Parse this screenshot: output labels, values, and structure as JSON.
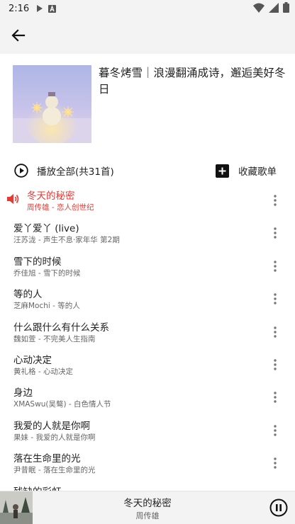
{
  "status": {
    "time": "2:16",
    "icons": [
      "play-icon",
      "a-icon",
      "wifi-icon",
      "signal-icon",
      "battery-icon"
    ]
  },
  "app_bar": {
    "back_icon": "arrow-left-icon"
  },
  "playlist": {
    "title": "暮冬烤雪｜浪漫翻涌成诗，邂逅美好冬日",
    "cover": "snowman-sparkler-cover"
  },
  "actions": {
    "play_all_label": "播放全部(共31首)",
    "collect_label": "收藏歌单"
  },
  "songs": [
    {
      "title": "冬天的秘密",
      "subtitle": "周传雄 - 恋人创世纪",
      "playing": true
    },
    {
      "title": "爱丫爱丫 (live)",
      "subtitle": "汪苏泷 - 声生不息·家年华 第2期"
    },
    {
      "title": "雪下的时候",
      "subtitle": "乔佳旭 - 雪下的时候"
    },
    {
      "title": "等的人",
      "subtitle": "芝麻Mochi - 等的人"
    },
    {
      "title": "什么跟什么有什么关系",
      "subtitle": "魏如萱 - 不完美人生指南"
    },
    {
      "title": "心动决定",
      "subtitle": "黄礼格 - 心动决定"
    },
    {
      "title": "身边",
      "subtitle": "XMASwu(吴骜) - 白色情人节"
    },
    {
      "title": "我爱的人就是你啊",
      "subtitle": "果妹 - 我爱的人就是你啊"
    },
    {
      "title": "落在生命里的光",
      "subtitle": "尹昔眠 - 落在生命里的光"
    },
    {
      "title": "残缺的彩虹",
      "subtitle": ""
    }
  ],
  "mini_player": {
    "title": "冬天的秘密",
    "artist": "周传雄"
  },
  "colors": {
    "accent": "#e53935",
    "background": "#f3f3f3"
  }
}
